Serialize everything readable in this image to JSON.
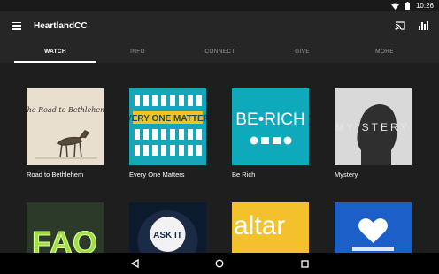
{
  "status_bar": {
    "time": "10:26"
  },
  "app_bar": {
    "title": "HeartlandCC"
  },
  "tabs": [
    {
      "label": "WATCH",
      "active": true
    },
    {
      "label": "INFO",
      "active": false
    },
    {
      "label": "CONNECT",
      "active": false
    },
    {
      "label": "GIVE",
      "active": false
    },
    {
      "label": "MORE",
      "active": false
    }
  ],
  "series": [
    {
      "title": "Road to Bethlehem",
      "art_text": "The Road to Bethlehem"
    },
    {
      "title": "Every One Matters",
      "art_text": "EVERY ONE MATTERS"
    },
    {
      "title": "Be Rich",
      "art_text": "BE•RICH"
    },
    {
      "title": "Mystery",
      "art_text": "MY STERY"
    },
    {
      "title": "",
      "art_text": "FAQ"
    },
    {
      "title": "",
      "art_text": "ASK IT"
    },
    {
      "title": "",
      "art_text": "altar"
    },
    {
      "title": "",
      "art_text": ""
    }
  ],
  "colors": {
    "accent_teal": "#17a6b9",
    "be_rich_bg": "#0eaabb",
    "altar_yellow": "#f2c12b",
    "heart_blue": "#1c5fc9"
  },
  "icons": [
    "wifi-icon",
    "battery-icon",
    "menu-icon",
    "cast-icon",
    "stats-icon",
    "back-icon",
    "home-icon",
    "recents-icon"
  ]
}
